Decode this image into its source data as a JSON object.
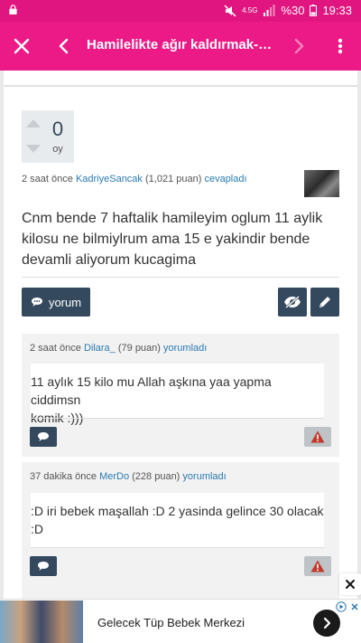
{
  "status_bar": {
    "network": "4.5G",
    "battery": "%30",
    "time": "19:33"
  },
  "app_bar": {
    "title": "Hamilelikte ağır kaldırmak-Hamil..."
  },
  "answer": {
    "votes": "0",
    "votes_unit": "oy",
    "time": "2 saat önce",
    "user": "KadriyeSancak",
    "points": "(1,021 puan)",
    "action": "cevapladı",
    "text": "Cnm bende 7 haftalik hamileyim oglum 11 aylik kilosu ne bilmiylrum ama 15 e yakindir bende devamli aliyorum kucagima",
    "comment_button": "yorum"
  },
  "comments": [
    {
      "time": "2 saat önce",
      "user": "Dilara_",
      "points": "(79 puan)",
      "action": "yorumladı",
      "lines": [
        "11 aylık 15 kilo mu Allah aşkına yaa yapma ciddimsn",
        "komik :)))"
      ]
    },
    {
      "time": "37 dakika önce",
      "user": "MerDo",
      "points": "(228 puan)",
      "action": "yorumladı",
      "lines": [
        ":D  iri  bebek maşallah  :D 2 yasinda gelince  30 olacak",
        ":D"
      ]
    }
  ],
  "ad": {
    "headline": "Gelecek Tüp Bebek Merkezi"
  },
  "icons": {
    "close": "close-icon",
    "back": "arrow-left-icon",
    "forward": "arrow-right-icon",
    "menu": "more-vertical-icon",
    "comment": "speech-bubble-icon",
    "hide": "eye-slash-icon",
    "edit": "pencil-icon",
    "flag": "warning-icon"
  },
  "colors": {
    "app_bar": "#ec1a86",
    "status_bar": "#e0157f",
    "button_dark": "#34495e",
    "link": "#2a7ab0",
    "flag_button": "#bdc3c7"
  }
}
